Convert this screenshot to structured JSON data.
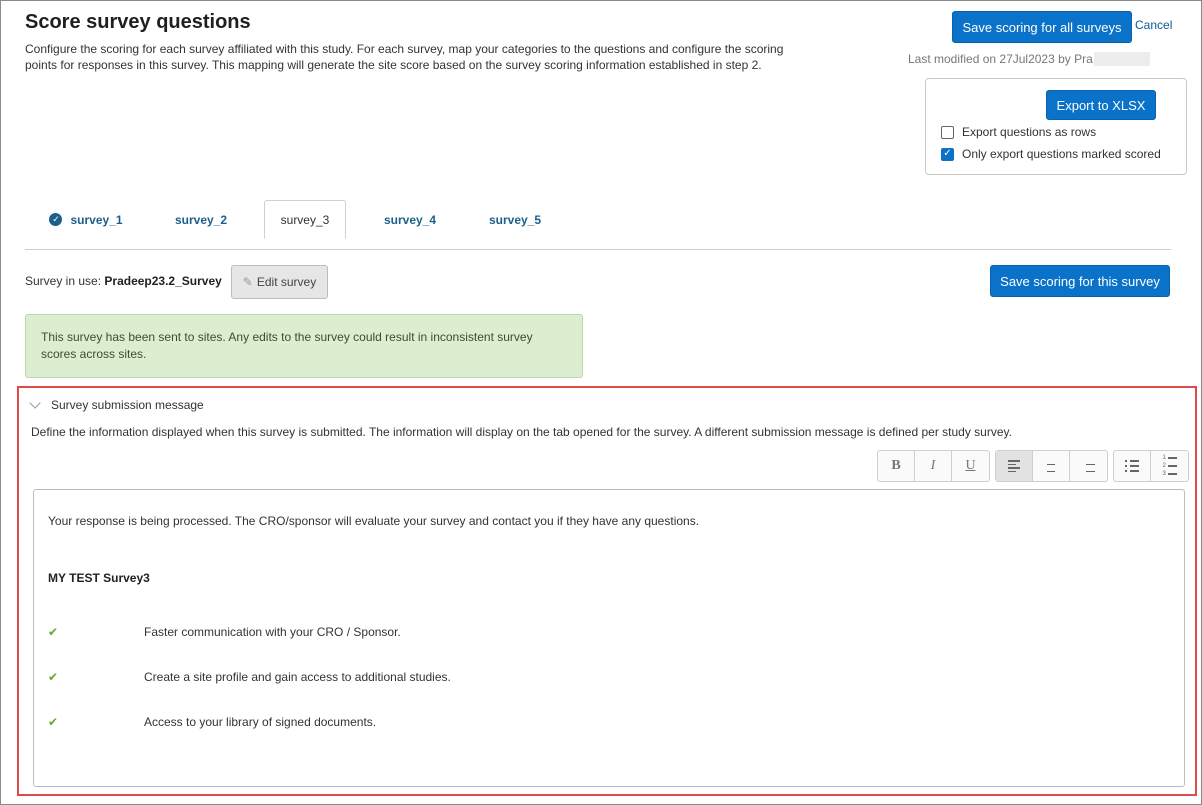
{
  "header": {
    "title": "Score survey questions",
    "description": "Configure the scoring for each survey affiliated with this study. For each survey, map your categories to the questions and configure the scoring points for responses in this survey. This mapping will generate the site score based on the survey scoring information established in step 2.",
    "save_all_label": "Save scoring for all surveys",
    "cancel_label": "Cancel",
    "last_modified": "Last modified on 27Jul2023 by Pra"
  },
  "export": {
    "button_label": "Export to XLSX",
    "options": [
      {
        "label": "Export questions as rows",
        "checked": false
      },
      {
        "label": "Only export questions marked scored",
        "checked": true
      }
    ]
  },
  "tabs": [
    {
      "label": "survey_1",
      "completed": true
    },
    {
      "label": "survey_2",
      "completed": false
    },
    {
      "label": "survey_3",
      "completed": false,
      "active": true
    },
    {
      "label": "survey_4",
      "completed": false
    },
    {
      "label": "survey_5",
      "completed": false
    }
  ],
  "survey": {
    "in_use_label": "Survey in use:",
    "in_use_name": "Pradeep23.2_Survey",
    "edit_label": "Edit survey",
    "save_this_label": "Save scoring for this survey",
    "alert": "This survey has been sent to sites. Any edits to the survey could result in inconsistent survey scores across sites."
  },
  "submission": {
    "header": "Survey submission message",
    "description": "Define the information displayed when this survey is submitted. The information will display on the tab opened for the survey. A different submission message is defined per study survey.",
    "toolbar": {
      "bold": "B",
      "italic": "I",
      "underline": "U",
      "active_alignment": "left"
    },
    "editor": {
      "intro": "Your response is being processed. The CRO/sponsor will evaluate your survey and contact you if they have any questions.",
      "title": "MY TEST Survey3",
      "items": [
        "Faster communication with your CRO / Sponsor.",
        "Create a site profile and gain access to additional studies.",
        "Access to your library of signed documents."
      ]
    }
  },
  "colors": {
    "primary": "#0a73c9",
    "tab_link": "#1b5f8a",
    "alert_bg": "#dcedd0",
    "highlight_border": "#e24a4a",
    "check_green": "#6aa82c"
  }
}
